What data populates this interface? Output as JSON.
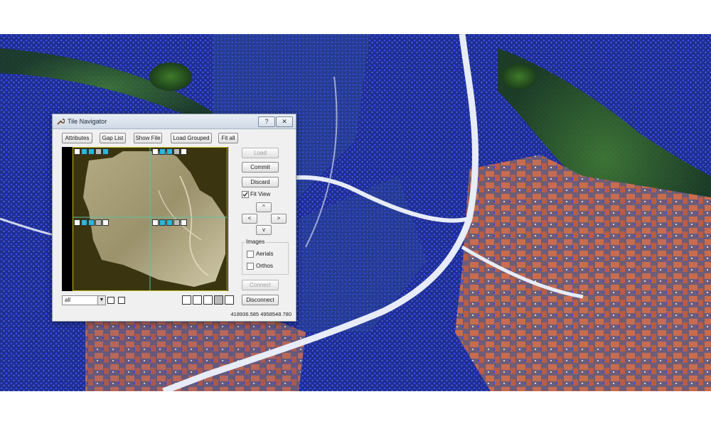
{
  "window": {
    "title": "Tile Navigator",
    "help_button": "?",
    "close_button": "✕"
  },
  "toolbar": {
    "attributes": "Attributes",
    "gap_list": "Gap List",
    "show_file": "Show File",
    "load_grouped": "Load Grouped",
    "fit_all": "Fit all"
  },
  "side": {
    "load": "Load",
    "commit": "Commit",
    "discard": "Discard",
    "fit_view": "Fit View",
    "fit_view_checked": true,
    "up": "^",
    "left": "<",
    "right": ">",
    "down": "v",
    "images_group": "Images",
    "aerials": "Aerials",
    "orthos": "Orthos",
    "connect": "Connect",
    "disconnect": "Disconnect"
  },
  "filter": {
    "value": "all"
  },
  "status": {
    "coordinates": "418936.585  4958548.780"
  },
  "icons": {
    "title": "wrench-icon",
    "tile_tools": [
      "filter-icon",
      "layers-icon",
      "globe-icon",
      "grid-icon",
      "color-swatch-icon"
    ],
    "bottom_tools": [
      "filter-icon",
      "layers-icon",
      "pointer-icon",
      "grid-icon",
      "blank-icon"
    ]
  },
  "colors": {
    "map_vegetation": "#1d2d8c",
    "point_cloud": "#2b3cff",
    "road": "#e8ecf7",
    "roof": "#c4674c",
    "tile_active": "#2ab7d8",
    "grid_line": "#5ec3a0",
    "frame": "#c8c020"
  }
}
